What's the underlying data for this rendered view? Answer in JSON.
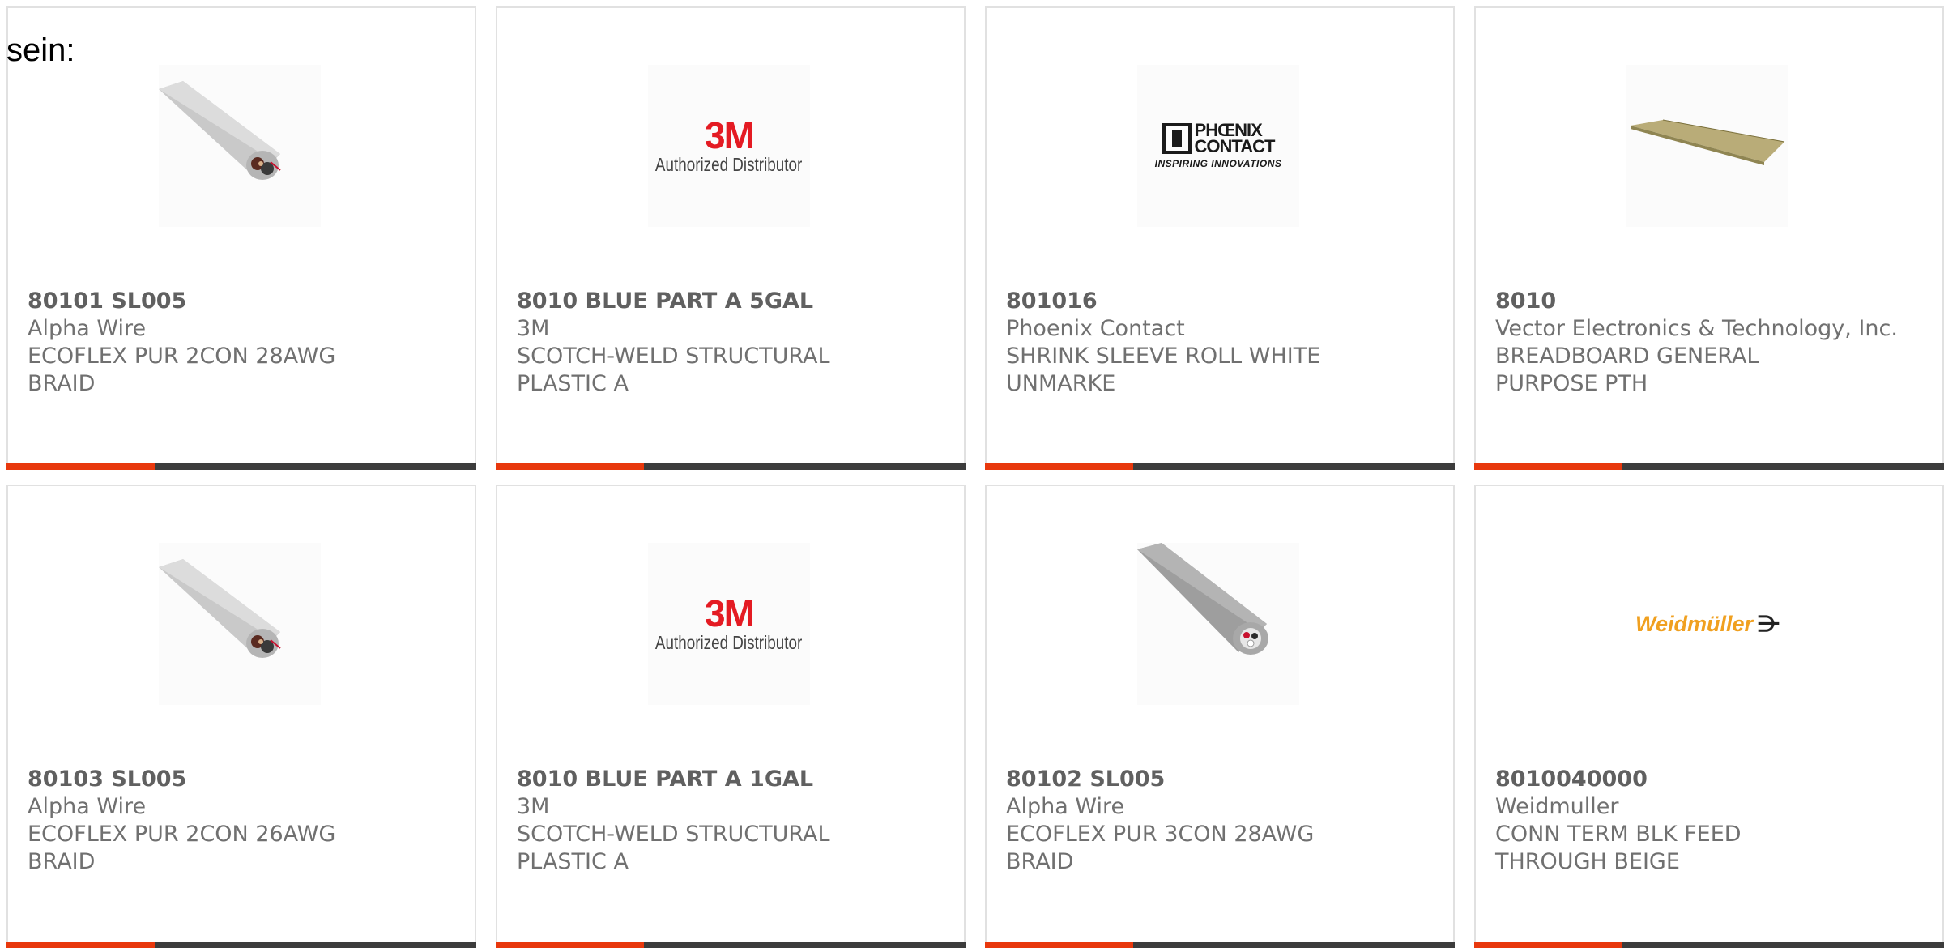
{
  "page": {
    "intro_text": "sein:"
  },
  "colors": {
    "accent": "#e8380d",
    "bar": "#3c3c3c",
    "border": "#e1e1e1",
    "text": "#707070"
  },
  "products": [
    {
      "part_number": "80101 SL005",
      "manufacturer": "Alpha Wire",
      "description": "ECOFLEX PUR 2CON 28AWG BRAID",
      "image": "cable-2con-icon"
    },
    {
      "part_number": "8010 BLUE PART A 5GAL",
      "manufacturer": "3M",
      "description": "SCOTCH-WELD STRUCTURAL PLASTIC A",
      "image": "3m-logo",
      "logo": {
        "brand": "3M",
        "tagline": "Authorized Distributor"
      }
    },
    {
      "part_number": "801016",
      "manufacturer": "Phoenix Contact",
      "description": "SHRINK SLEEVE ROLL WHITE UNMARKE",
      "image": "phoenix-contact-logo",
      "logo": {
        "line1": "PHŒNIX",
        "line2": "CONTACT",
        "tagline": "INSPIRING INNOVATIONS"
      }
    },
    {
      "part_number": "8010",
      "manufacturer": "Vector Electronics & Technology, Inc.",
      "description": "BREADBOARD GENERAL PURPOSE PTH",
      "image": "breadboard-icon"
    },
    {
      "part_number": "80103 SL005",
      "manufacturer": "Alpha Wire",
      "description": "ECOFLEX PUR 2CON 26AWG BRAID",
      "image": "cable-2con-icon"
    },
    {
      "part_number": "8010 BLUE PART A 1GAL",
      "manufacturer": "3M",
      "description": "SCOTCH-WELD STRUCTURAL PLASTIC A",
      "image": "3m-logo",
      "logo": {
        "brand": "3M",
        "tagline": "Authorized Distributor"
      }
    },
    {
      "part_number": "80102 SL005",
      "manufacturer": "Alpha Wire",
      "description": "ECOFLEX PUR 3CON 28AWG BRAID",
      "image": "cable-3con-icon"
    },
    {
      "part_number": "8010040000",
      "manufacturer": "Weidmuller",
      "description": "CONN TERM BLK FEED THROUGH BEIGE",
      "image": "weidmuller-logo",
      "logo": {
        "brand": "Weidmüller"
      }
    }
  ]
}
